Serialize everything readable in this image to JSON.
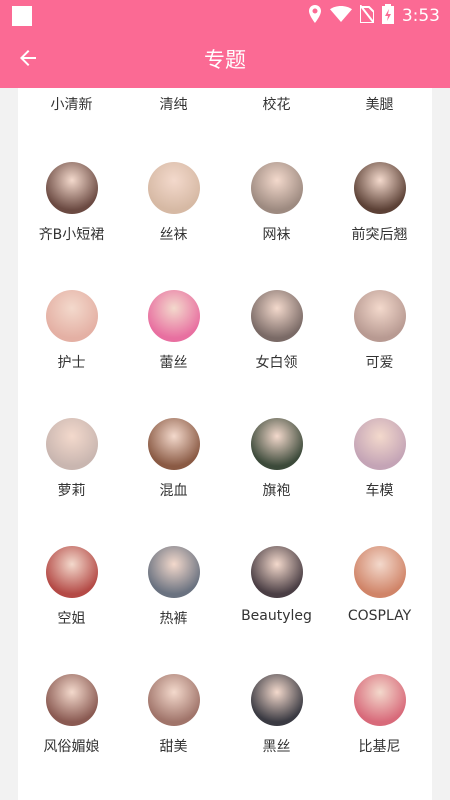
{
  "status_bar": {
    "time": "3:53",
    "icons": [
      "notification-square-icon",
      "location-icon",
      "wifi-icon",
      "no-sim-icon",
      "battery-charging-icon"
    ]
  },
  "app_bar": {
    "title": "专题",
    "back_icon": "arrow-left-icon"
  },
  "topics": {
    "top_row": [
      "小清新",
      "清纯",
      "校花",
      "美腿"
    ],
    "rows": [
      [
        {
          "label": "齐B小短裙",
          "avatar_color": "#6b4a42"
        },
        {
          "label": "丝袜",
          "avatar_color": "#d6b9a4"
        },
        {
          "label": "网袜",
          "avatar_color": "#9d8a80"
        },
        {
          "label": "前突后翘",
          "avatar_color": "#5c4136"
        }
      ],
      [
        {
          "label": "护士",
          "avatar_color": "#e4b0a4"
        },
        {
          "label": "蕾丝",
          "avatar_color": "#e86fa0"
        },
        {
          "label": "女白领",
          "avatar_color": "#7a6a66"
        },
        {
          "label": "可爱",
          "avatar_color": "#b89a92"
        }
      ],
      [
        {
          "label": "萝莉",
          "avatar_color": "#c9b6b0"
        },
        {
          "label": "混血",
          "avatar_color": "#8a5a44"
        },
        {
          "label": "旗袍",
          "avatar_color": "#3c4a3a"
        },
        {
          "label": "车模",
          "avatar_color": "#c4a4b6"
        }
      ],
      [
        {
          "label": "空姐",
          "avatar_color": "#b44a46"
        },
        {
          "label": "热裤",
          "avatar_color": "#6a7280"
        },
        {
          "label": "Beautyleg",
          "avatar_color": "#4a3e44"
        },
        {
          "label": "COSPLAY",
          "avatar_color": "#d08468"
        }
      ],
      [
        {
          "label": "风俗媚娘",
          "avatar_color": "#8a5a52"
        },
        {
          "label": "甜美",
          "avatar_color": "#a0746a"
        },
        {
          "label": "黑丝",
          "avatar_color": "#3a3a42"
        },
        {
          "label": "比基尼",
          "avatar_color": "#d86a7a"
        }
      ]
    ]
  }
}
